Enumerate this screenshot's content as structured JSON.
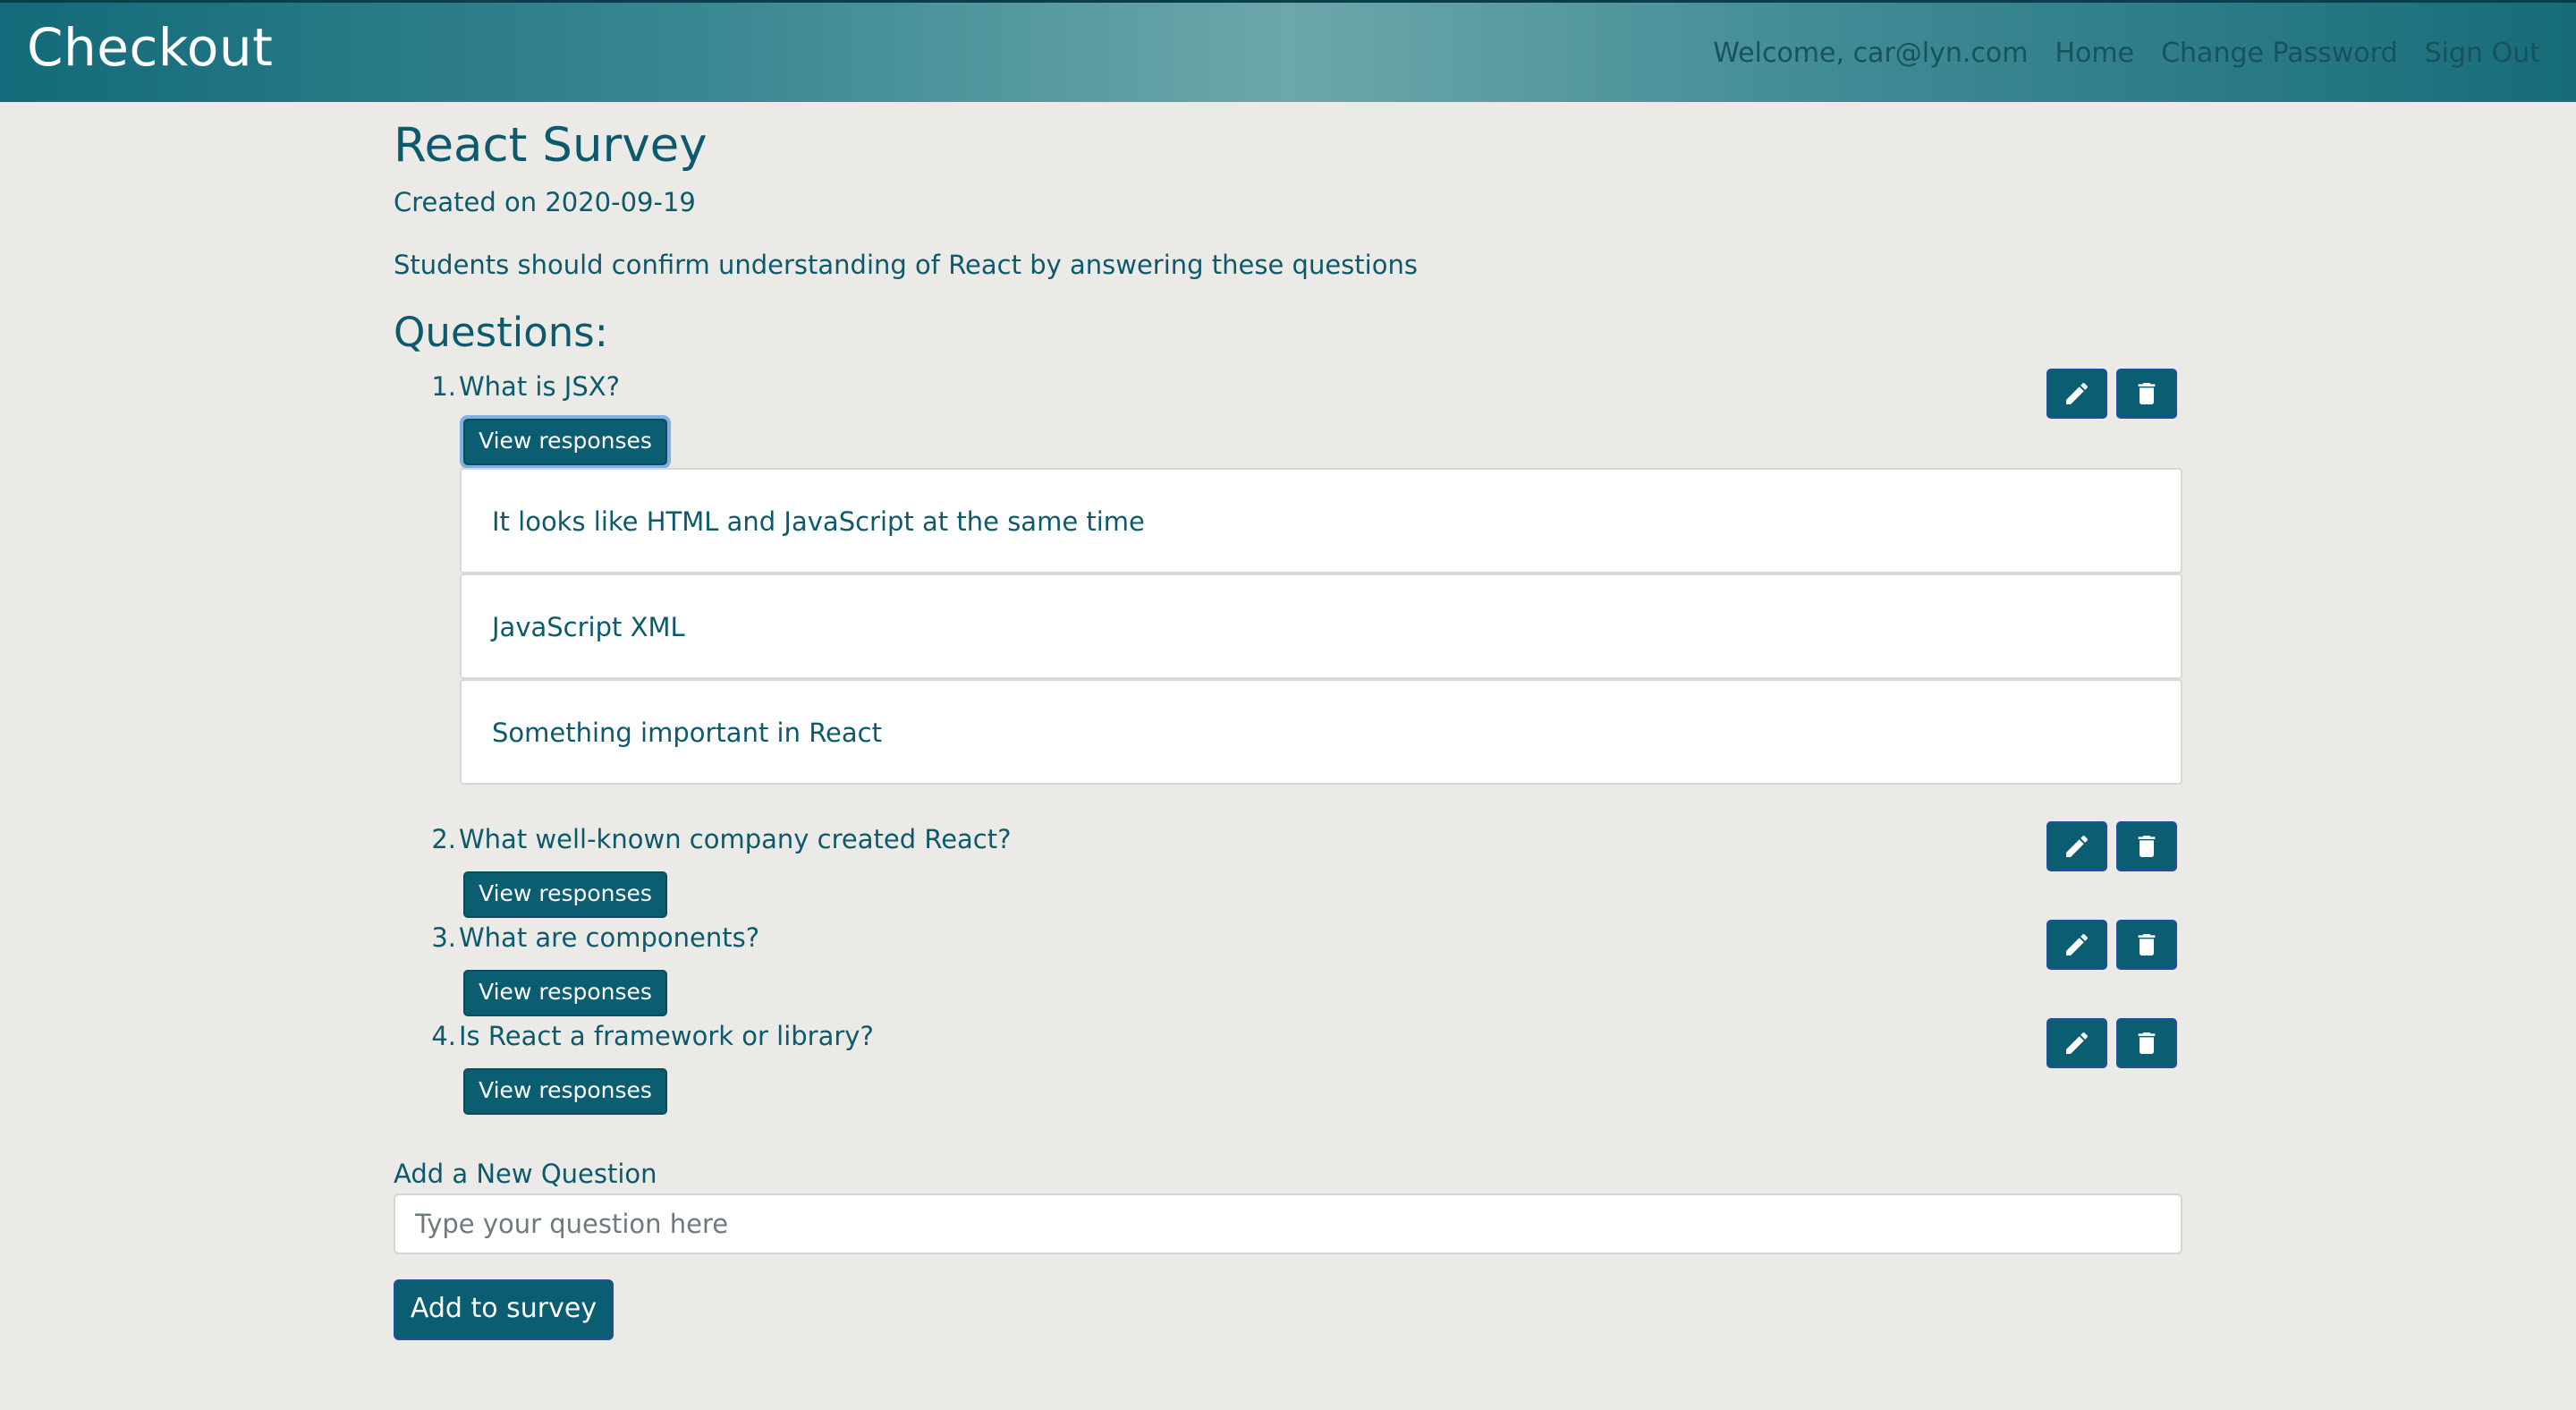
{
  "navbar": {
    "brand": "Checkout",
    "welcome": "Welcome, car@lyn.com",
    "links": [
      "Home",
      "Change Password",
      "Sign Out"
    ]
  },
  "survey": {
    "title": "React Survey",
    "created": "Created on 2020-09-19",
    "description": "Students should confirm understanding of React by answering these questions",
    "questions_heading": "Questions:",
    "questions": [
      {
        "number": "1.",
        "text": "What is JSX?",
        "view_label": "View responses",
        "responses": [
          "It looks like HTML and JavaScript at the same time",
          "JavaScript XML",
          "Something important in React"
        ]
      },
      {
        "number": "2.",
        "text": "What well-known company created React?",
        "view_label": "View responses"
      },
      {
        "number": "3.",
        "text": "What are components?",
        "view_label": "View responses"
      },
      {
        "number": "4.",
        "text": "Is React a framework or library?",
        "view_label": "View responses"
      }
    ]
  },
  "add_question": {
    "label": "Add a New Question",
    "placeholder": "Type your question here",
    "value": "",
    "button_label": "Add to survey"
  },
  "icons": {
    "edit": "pencil-icon",
    "delete": "trash-icon"
  },
  "colors": {
    "primary": "#0b5d72",
    "text": "#0c5a6c",
    "background": "#ebeae6"
  }
}
